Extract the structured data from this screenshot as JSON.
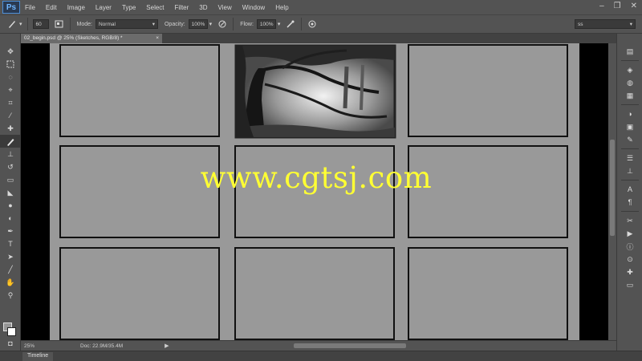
{
  "app": {
    "logo": "Ps"
  },
  "menu": [
    "File",
    "Edit",
    "Image",
    "Layer",
    "Type",
    "Select",
    "Filter",
    "3D",
    "View",
    "Window",
    "Help"
  ],
  "window_controls": {
    "minimize": "–",
    "restore": "❐",
    "close": "✕"
  },
  "options": {
    "brush_size": "60",
    "mode_label": "Mode:",
    "mode_value": "Normal",
    "opacity_label": "Opacity:",
    "opacity_value": "100%",
    "flow_label": "Flow:",
    "flow_value": "100%",
    "workspace_value": "ss"
  },
  "document": {
    "tab_title": "02_begin.psd @ 25% (Sketches, RGB/8) *",
    "close": "×"
  },
  "status": {
    "zoom": "25%",
    "doc_info": "Doc: 22.9M/35.4M"
  },
  "timeline": {
    "label": "Timeline"
  },
  "watermark": {
    "text": "www.cgtsj.com",
    "color": "#ffff33"
  },
  "colors": {
    "foreground": "#959595",
    "background": "#ffffff"
  }
}
